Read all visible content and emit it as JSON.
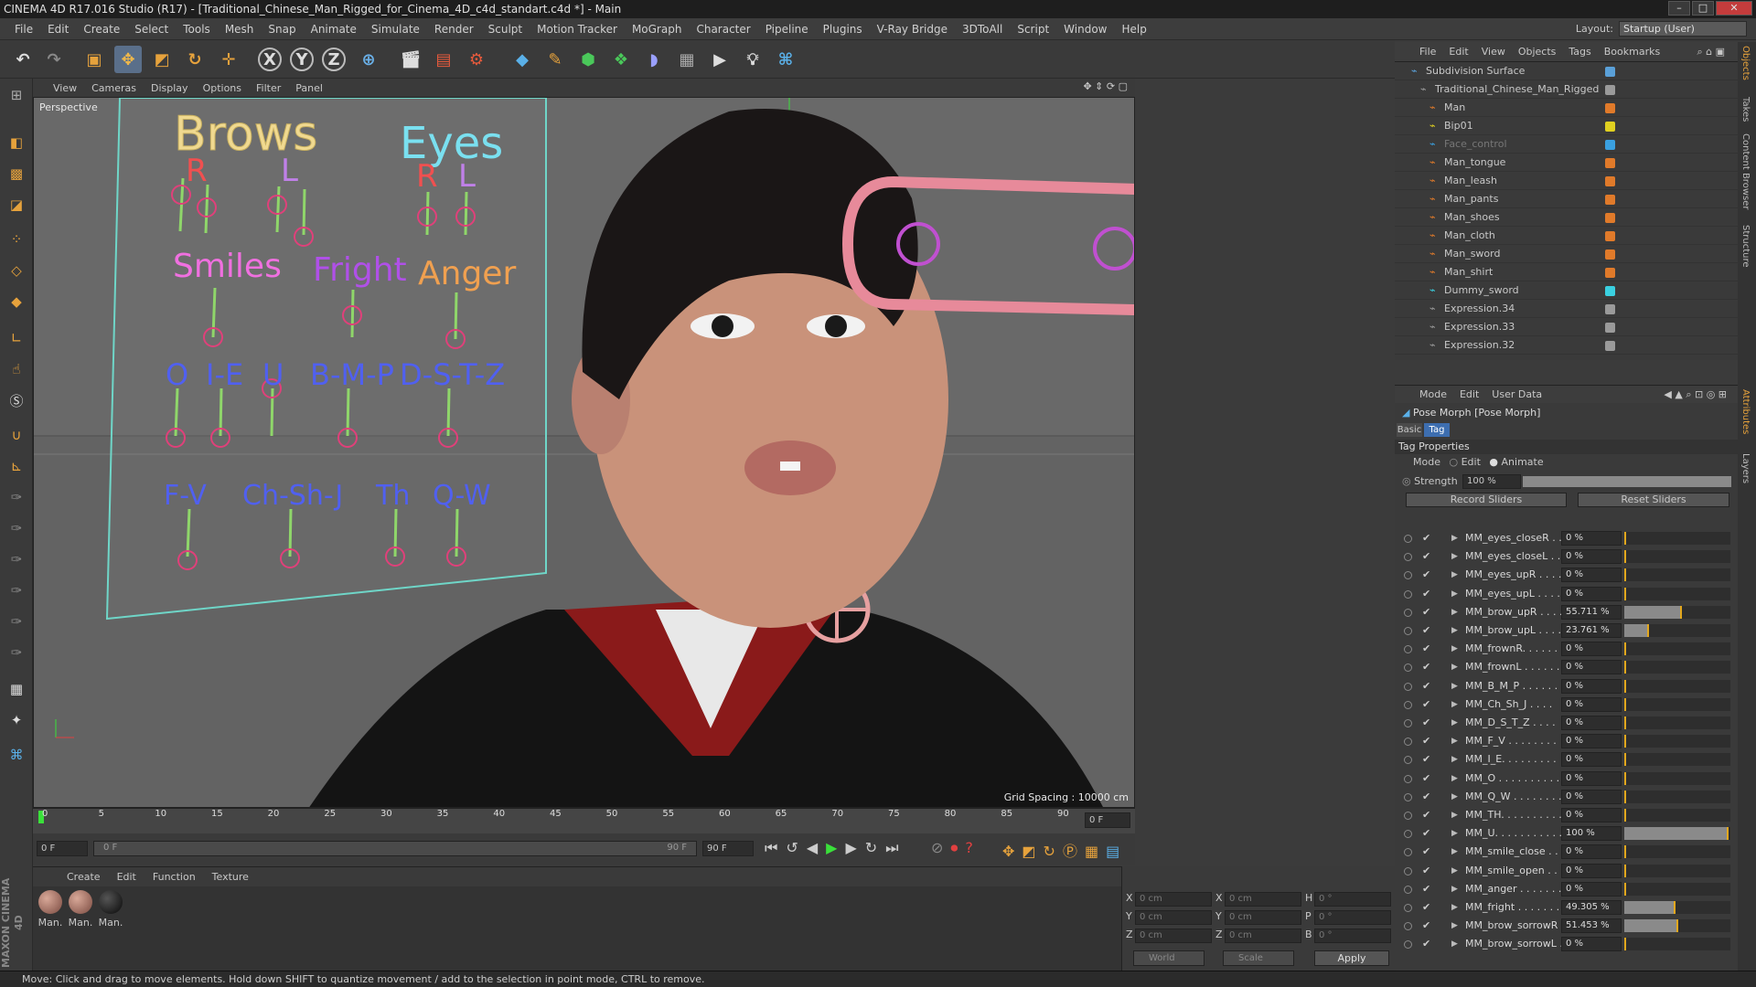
{
  "title_bar": {
    "title": "CINEMA 4D R17.016 Studio (R17) - [Traditional_Chinese_Man_Rigged_for_Cinema_4D_c4d_standart.c4d *] - Main"
  },
  "menu": [
    "File",
    "Edit",
    "Create",
    "Select",
    "Tools",
    "Mesh",
    "Snap",
    "Animate",
    "Simulate",
    "Render",
    "Sculpt",
    "Motion Tracker",
    "MoGraph",
    "Character",
    "Pipeline",
    "Plugins",
    "V-Ray Bridge",
    "3DToAll",
    "Script",
    "Window",
    "Help"
  ],
  "layout": {
    "label": "Layout:",
    "value": "Startup (User)"
  },
  "toolbar": {
    "axis_x": "X",
    "axis_y": "Y",
    "axis_z": "Z"
  },
  "viewport": {
    "menu": [
      "View",
      "Cameras",
      "Display",
      "Options",
      "Filter",
      "Panel"
    ],
    "label": "Perspective",
    "grid_spacing": "Grid Spacing : 10000 cm",
    "rig_labels": {
      "brows": "Brows",
      "eyes": "Eyes",
      "r1": "R",
      "l1": "L",
      "r2": "R",
      "l2": "L",
      "smiles": "Smiles",
      "fright": "Fright",
      "anger": "Anger",
      "o": "O",
      "ie": "I-E",
      "u": "U",
      "bmp": "B-M-P",
      "dstz": "D-S-T-Z",
      "fv": "F-V",
      "chshj": "Ch-Sh-J",
      "th": "Th",
      "qw": "Q-W"
    }
  },
  "timeline": {
    "ticks": [
      "0",
      "5",
      "10",
      "15",
      "20",
      "25",
      "30",
      "35",
      "40",
      "45",
      "50",
      "55",
      "60",
      "65",
      "70",
      "75",
      "80",
      "85",
      "90"
    ],
    "current_frame": "0 F",
    "start_field": "0 F",
    "range_start": "0 F",
    "range_end": "90 F",
    "end_field": "90 F"
  },
  "materials": {
    "menu": [
      "Create",
      "Edit",
      "Function",
      "Texture"
    ],
    "items": [
      {
        "label": "Man."
      },
      {
        "label": "Man."
      },
      {
        "label": "Man."
      }
    ]
  },
  "coords": {
    "rows": [
      {
        "a": "X",
        "av": "0 cm",
        "b": "X",
        "bv": "0 cm",
        "c": "H",
        "cv": "0 °"
      },
      {
        "a": "Y",
        "av": "0 cm",
        "b": "Y",
        "bv": "0 cm",
        "c": "P",
        "cv": "0 °"
      },
      {
        "a": "Z",
        "av": "0 cm",
        "b": "Z",
        "bv": "0 cm",
        "c": "B",
        "cv": "0 °"
      }
    ],
    "mode": "World",
    "scale": "Scale",
    "apply": "Apply"
  },
  "status": "Move: Click and drag to move elements. Hold down SHIFT to quantize movement / add to the selection in point mode, CTRL to remove.",
  "brand": "MAXON CINEMA 4D",
  "object_manager": {
    "menu": [
      "File",
      "Edit",
      "View",
      "Objects",
      "Tags",
      "Bookmarks"
    ],
    "objects": [
      {
        "name": "Subdivision Surface",
        "color": "#5aa0d8"
      },
      {
        "name": "Traditional_Chinese_Man_Rigged",
        "color": "#9a9a9a"
      },
      {
        "name": "Man",
        "color": "#e07a2a"
      },
      {
        "name": "Bip01",
        "color": "#e0d020"
      },
      {
        "name": "Face_control",
        "color": "#3aa0e0"
      },
      {
        "name": "Man_tongue",
        "color": "#e07a2a"
      },
      {
        "name": "Man_leash",
        "color": "#e07a2a"
      },
      {
        "name": "Man_pants",
        "color": "#e07a2a"
      },
      {
        "name": "Man_shoes",
        "color": "#e07a2a"
      },
      {
        "name": "Man_cloth",
        "color": "#e07a2a"
      },
      {
        "name": "Man_sword",
        "color": "#e07a2a"
      },
      {
        "name": "Man_shirt",
        "color": "#e07a2a"
      },
      {
        "name": "Dummy_sword",
        "color": "#3ad0e0"
      },
      {
        "name": "Expression.34",
        "color": "#9a9a9a"
      },
      {
        "name": "Expression.33",
        "color": "#9a9a9a"
      },
      {
        "name": "Expression.32",
        "color": "#9a9a9a"
      }
    ]
  },
  "attributes": {
    "menu": [
      "Mode",
      "Edit",
      "User Data"
    ],
    "header": "Pose Morph [Pose Morph]",
    "tabs": [
      "Basic",
      "Tag"
    ],
    "section": "Tag Properties",
    "mode_label": "Mode",
    "mode_edit": "Edit",
    "mode_animate": "Animate",
    "strength_label": "Strength",
    "strength_value": "100 %",
    "strength": 1.0,
    "record_sliders": "Record Sliders",
    "reset_sliders": "Reset Sliders",
    "sliders": [
      {
        "name": "MM_eyes_closeR . .",
        "value": "0 %",
        "level": 0
      },
      {
        "name": "MM_eyes_closeL . .",
        "value": "0 %",
        "level": 0
      },
      {
        "name": "MM_eyes_upR . . . .",
        "value": "0 %",
        "level": 0
      },
      {
        "name": "MM_eyes_upL . . . .",
        "value": "0 %",
        "level": 0
      },
      {
        "name": "MM_brow_upR . . . .",
        "value": "55.711 %",
        "level": 0.557
      },
      {
        "name": "MM_brow_upL . . . .",
        "value": "23.761 %",
        "level": 0.238
      },
      {
        "name": "MM_frownR. . . . . .",
        "value": "0 %",
        "level": 0
      },
      {
        "name": "MM_frownL . . . . . .",
        "value": "0 %",
        "level": 0
      },
      {
        "name": "MM_B_M_P . . . . . .",
        "value": "0 %",
        "level": 0
      },
      {
        "name": "MM_Ch_Sh_J . . . .",
        "value": "0 %",
        "level": 0
      },
      {
        "name": "MM_D_S_T_Z . . . .",
        "value": "0 %",
        "level": 0
      },
      {
        "name": "MM_F_V . . . . . . . .",
        "value": "0 %",
        "level": 0
      },
      {
        "name": "MM_I_E. . . . . . . . .",
        "value": "0 %",
        "level": 0
      },
      {
        "name": "MM_O . . . . . . . . . .",
        "value": "0 %",
        "level": 0
      },
      {
        "name": "MM_Q_W . . . . . . . .",
        "value": "0 %",
        "level": 0
      },
      {
        "name": "MM_TH. . . . . . . . . .",
        "value": "0 %",
        "level": 0
      },
      {
        "name": "MM_U. . . . . . . . . . .",
        "value": "100 %",
        "level": 1.0
      },
      {
        "name": "MM_smile_close . . .",
        "value": "0 %",
        "level": 0
      },
      {
        "name": "MM_smile_open . . .",
        "value": "0 %",
        "level": 0
      },
      {
        "name": "MM_anger . . . . . . .",
        "value": "0 %",
        "level": 0
      },
      {
        "name": "MM_fright . . . . . . .",
        "value": "49.305 %",
        "level": 0.493
      },
      {
        "name": "MM_brow_sorrowR .",
        "value": "51.453 %",
        "level": 0.515
      },
      {
        "name": "MM_brow_sorrowL .",
        "value": "0 %",
        "level": 0
      }
    ]
  },
  "right_tabs": [
    "Objects",
    "Takes",
    "Content Browser",
    "Structure",
    "Attributes",
    "Layers"
  ]
}
